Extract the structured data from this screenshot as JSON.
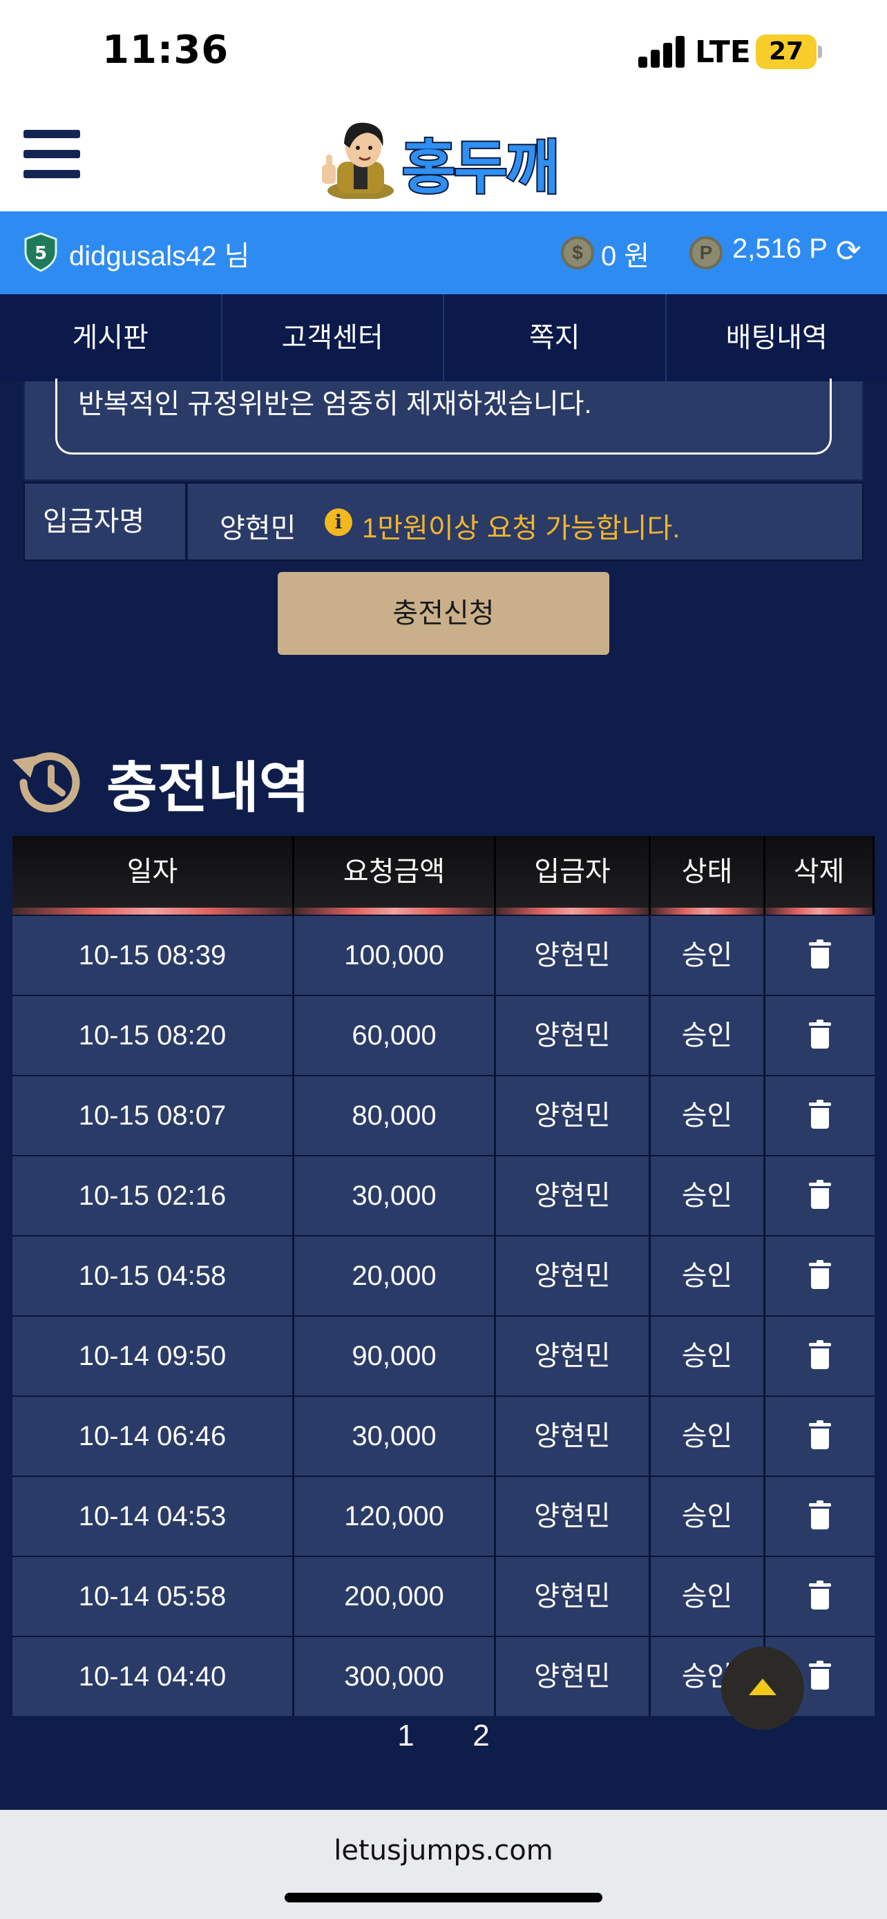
{
  "status_bar": {
    "time": "11:36",
    "network": "LTE",
    "battery": "27"
  },
  "header": {
    "logo_text": "홍두깨"
  },
  "user_bar": {
    "level": "5",
    "username": "didgusals42 님",
    "money_icon": "$",
    "money": "0 원",
    "point_icon": "P",
    "points": "2,516 P",
    "refresh_icon": "⟳"
  },
  "nav": {
    "items": [
      "게시판",
      "고객센터",
      "쪽지",
      "배팅내역"
    ]
  },
  "form": {
    "notice_text": "반복적인 규정위반은 엄중히 제재하겠습니다.",
    "depositor_label": "입금자명",
    "depositor_name": "양현민",
    "info_icon": "i",
    "depositor_note": "1만원이상 요청 가능합니다.",
    "submit_label": "충전신청"
  },
  "history": {
    "title": "충전내역",
    "columns": [
      "일자",
      "요청금액",
      "입금자",
      "상태",
      "삭제"
    ],
    "rows": [
      {
        "date": "10-15 08:39",
        "amount": "100,000",
        "depositor": "양현민",
        "status": "승인"
      },
      {
        "date": "10-15 08:20",
        "amount": "60,000",
        "depositor": "양현민",
        "status": "승인"
      },
      {
        "date": "10-15 08:07",
        "amount": "80,000",
        "depositor": "양현민",
        "status": "승인"
      },
      {
        "date": "10-15 02:16",
        "amount": "30,000",
        "depositor": "양현민",
        "status": "승인"
      },
      {
        "date": "10-15 04:58",
        "amount": "20,000",
        "depositor": "양현민",
        "status": "승인"
      },
      {
        "date": "10-14 09:50",
        "amount": "90,000",
        "depositor": "양현민",
        "status": "승인"
      },
      {
        "date": "10-14 06:46",
        "amount": "30,000",
        "depositor": "양현민",
        "status": "승인"
      },
      {
        "date": "10-14 04:53",
        "amount": "120,000",
        "depositor": "양현민",
        "status": "승인"
      },
      {
        "date": "10-14 05:58",
        "amount": "200,000",
        "depositor": "양현민",
        "status": "승인"
      },
      {
        "date": "10-14 04:40",
        "amount": "300,000",
        "depositor": "양현민",
        "status": "승인"
      }
    ]
  },
  "pagination": {
    "pages": [
      "1",
      "2"
    ]
  },
  "browser": {
    "url": "letusjumps.com"
  },
  "colors": {
    "user_bar": "#2e8bf2",
    "nav": "#0b1a4a",
    "page_bg": "#0f1d4a",
    "row_bg": "#2b3b68",
    "submit_btn": "#c9b08a",
    "note_yellow": "#f3b52a"
  }
}
